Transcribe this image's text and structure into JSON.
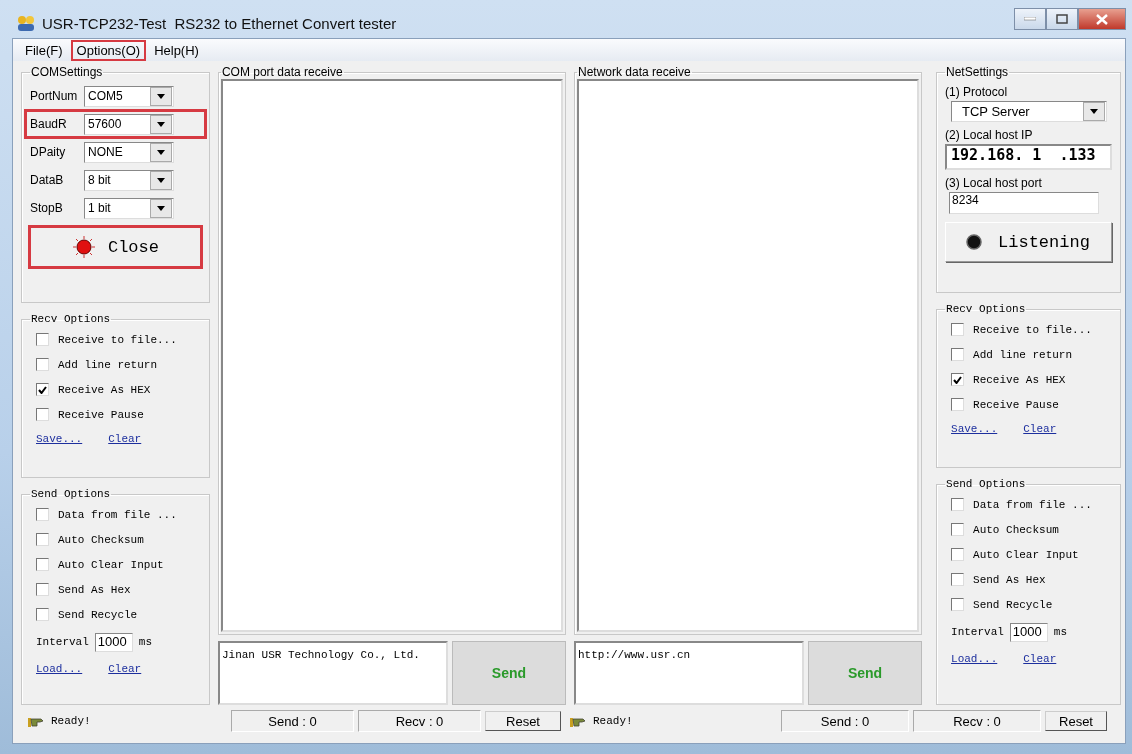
{
  "window": {
    "title": "USR-TCP232-Test  RS232 to Ethernet Convert tester"
  },
  "menu": [
    {
      "label": "File(F)",
      "highlighted": false
    },
    {
      "label": "Options(O)",
      "highlighted": true
    },
    {
      "label": "Help(H)",
      "highlighted": false
    }
  ],
  "com_settings": {
    "title": "COMSettings",
    "fields": [
      {
        "label": "PortNum",
        "value": "COM5",
        "highlighted": false
      },
      {
        "label": "BaudR",
        "value": "57600",
        "highlighted": true
      },
      {
        "label": "DPaity",
        "value": "NONE",
        "highlighted": false
      },
      {
        "label": "DataB",
        "value": "8 bit",
        "highlighted": false
      },
      {
        "label": "StopB",
        "value": "1 bit",
        "highlighted": false
      }
    ],
    "button": {
      "label": "Close",
      "lamp_on": true,
      "highlighted": true
    }
  },
  "com_receive": {
    "title": "COM port data receive"
  },
  "com_send": {
    "text": "Jinan USR Technology Co., Ltd.",
    "button": "Send"
  },
  "net_receive": {
    "title": "Network data receive"
  },
  "net_send": {
    "text": "http://www.usr.cn",
    "button": "Send"
  },
  "net_settings": {
    "title": "NetSettings",
    "protocol_label": "(1) Protocol",
    "protocol": "TCP Server",
    "ip_label": "(2) Local host IP",
    "ip": "192.168. 1  .133",
    "port_label": "(3) Local host port",
    "port": "8234",
    "button": {
      "label": "Listening",
      "lamp_on": false,
      "highlighted": false
    }
  },
  "com_recv_options": {
    "title": "Recv Options",
    "options": [
      {
        "label": "Receive to file...",
        "checked": false
      },
      {
        "label": "Add line return",
        "checked": false
      },
      {
        "label": "Receive As HEX",
        "checked": true
      },
      {
        "label": "Receive Pause",
        "checked": false
      }
    ],
    "links": [
      "Save...",
      "Clear"
    ]
  },
  "com_send_options": {
    "title": "Send Options",
    "options": [
      {
        "label": "Data from file ...",
        "checked": false
      },
      {
        "label": "Auto Checksum",
        "checked": false
      },
      {
        "label": "Auto Clear Input",
        "checked": false
      },
      {
        "label": "Send As Hex",
        "checked": false
      },
      {
        "label": "Send Recycle",
        "checked": false
      }
    ],
    "interval_label": "Interval",
    "interval": "1000",
    "interval_unit": "ms",
    "links": [
      "Load...",
      "Clear"
    ]
  },
  "net_recv_options": {
    "title": "Recv Options",
    "options": [
      {
        "label": "Receive to file...",
        "checked": false
      },
      {
        "label": "Add line return",
        "checked": false
      },
      {
        "label": "Receive As HEX",
        "checked": true
      },
      {
        "label": "Receive Pause",
        "checked": false
      }
    ],
    "links": [
      "Save...",
      "Clear"
    ]
  },
  "net_send_options": {
    "title": "Send Options",
    "options": [
      {
        "label": "Data from file ...",
        "checked": false
      },
      {
        "label": "Auto Checksum",
        "checked": false
      },
      {
        "label": "Auto Clear Input",
        "checked": false
      },
      {
        "label": "Send As Hex",
        "checked": false
      },
      {
        "label": "Send Recycle",
        "checked": false
      }
    ],
    "interval_label": "Interval",
    "interval": "1000",
    "interval_unit": "ms",
    "links": [
      "Load...",
      "Clear"
    ]
  },
  "com_status": {
    "message": "Ready!",
    "send": "Send : 0",
    "recv": "Recv : 0",
    "reset": "Reset"
  },
  "net_status": {
    "message": "Ready!",
    "send": "Send : 0",
    "recv": "Recv : 0",
    "reset": "Reset"
  }
}
